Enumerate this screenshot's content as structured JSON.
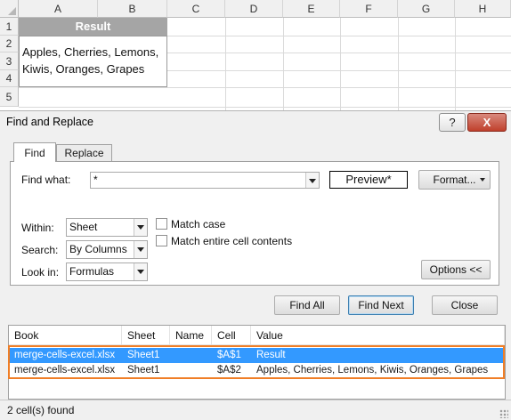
{
  "sheet": {
    "columns": [
      "A",
      "B",
      "C",
      "D",
      "E",
      "F",
      "G",
      "H"
    ],
    "rows": [
      "1",
      "2",
      "3",
      "4",
      "5"
    ],
    "result_header": "Result",
    "merged_line1": "Apples, Cherries, Lemons,",
    "merged_line2": "Kiwis, Oranges, Grapes"
  },
  "dialog": {
    "title": "Find and Replace",
    "help_label": "?",
    "close_label": "X",
    "tabs": [
      {
        "label": "Find"
      },
      {
        "label": "Replace"
      }
    ],
    "find_what_label": "Find what:",
    "find_what_value": "*",
    "preview_label": "Preview*",
    "format_label": "Format...",
    "within_label": "Within:",
    "within_value": "Sheet",
    "search_label": "Search:",
    "search_value": "By Columns",
    "lookin_label": "Look in:",
    "lookin_value": "Formulas",
    "match_case_label": "Match case",
    "match_entire_label": "Match entire cell contents",
    "options_label": "Options <<",
    "find_all_label": "Find All",
    "find_next_label": "Find Next",
    "close_button_label": "Close",
    "results": {
      "headers": [
        "Book",
        "Sheet",
        "Name",
        "Cell",
        "Value"
      ],
      "rows": [
        {
          "book": "merge-cells-excel.xlsx",
          "sheet": "Sheet1",
          "name": "",
          "cell": "$A$1",
          "value": "Result"
        },
        {
          "book": "merge-cells-excel.xlsx",
          "sheet": "Sheet1",
          "name": "",
          "cell": "$A$2",
          "value": "Apples, Cherries, Lemons, Kiwis, Oranges, Grapes"
        }
      ]
    },
    "status": "2 cell(s) found"
  },
  "colors": {
    "accent_selection": "#3399ff",
    "highlight_outline": "#f07e26",
    "header_fill": "#a5a5a5"
  }
}
